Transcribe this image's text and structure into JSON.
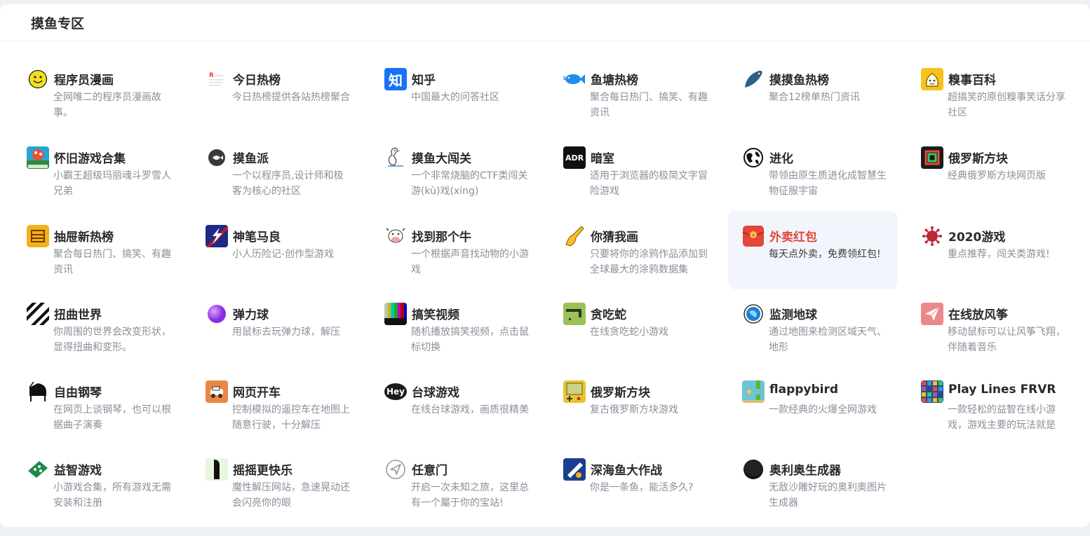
{
  "section": {
    "title": "摸鱼专区"
  },
  "items": [
    {
      "title": "程序员漫画",
      "desc": "全网唯二的程序员漫画故事。",
      "icon": "smiley-icon",
      "color": "#f4e01a"
    },
    {
      "title": "今日热榜",
      "desc": "今日热榜提供各站热榜聚合",
      "icon": "tophub-icon",
      "color": "#e34a3c"
    },
    {
      "title": "知乎",
      "desc": "中国最大的问答社区",
      "icon": "zhihu-icon",
      "color": "#1772f6",
      "glyph": "知"
    },
    {
      "title": "鱼塘热榜",
      "desc": "聚合每日热门、搞笑、有趣资讯",
      "icon": "fish-blue-icon",
      "color": "#1e8ee8"
    },
    {
      "title": "摸摸鱼热榜",
      "desc": "聚合12榜单热门资讯",
      "icon": "fish-dark-icon",
      "color": "#2b5f86"
    },
    {
      "title": "糗事百科",
      "desc": "超搞笑的原创糗事笑话分享社区",
      "icon": "qiushi-icon",
      "color": "#f7c21a"
    },
    {
      "title": "怀旧游戏合集",
      "desc": "小霸王超级玛丽魂斗罗雪人兄弟",
      "icon": "retro-game-icon",
      "color": "#2aa3d6"
    },
    {
      "title": "摸鱼派",
      "desc": "一个以程序员,设计师和极客为核心的社区",
      "icon": "fishpi-icon",
      "color": "#3a3a3a"
    },
    {
      "title": "摸鱼大闯关",
      "desc": "一个非常烧脑的CTF类闯关游(kù)戏(xíng)",
      "icon": "duck-icon",
      "color": "#444444"
    },
    {
      "title": "暗室",
      "desc": "适用于浏览器的极简文字冒险游戏",
      "icon": "adr-icon",
      "color": "#111111",
      "glyph": "ADR"
    },
    {
      "title": "进化",
      "desc": "带领由原生质进化成智慧生物征服宇宙",
      "icon": "globe-icon",
      "color": "#111111"
    },
    {
      "title": "俄罗斯方块",
      "desc": "经典俄罗斯方块网页版",
      "icon": "tetris-icon",
      "color": "#1b1b1b"
    },
    {
      "title": "抽屉新热榜",
      "desc": "聚合每日热门、搞笑、有趣资讯",
      "icon": "drawer-icon",
      "color": "#f2b318"
    },
    {
      "title": "神笔马良",
      "desc": "小人历险记-创作型游戏",
      "icon": "magic-pen-icon",
      "color": "#1f2a86"
    },
    {
      "title": "找到那个牛",
      "desc": "一个根据声音找动物的小游戏",
      "icon": "cow-icon",
      "color": "#e9a7a0"
    },
    {
      "title": "你猜我画",
      "desc": "只要将你的涂鸦作品添加到全球最大的涂鸦数据集",
      "icon": "hand-draw-icon",
      "color": "#f5c023"
    },
    {
      "title": "外卖红包",
      "desc": "每天点外卖，免费领红包!",
      "icon": "red-packet-icon",
      "color": "#e4463c",
      "active": true
    },
    {
      "title": "2020游戏",
      "desc": "重点推荐，闯关类游戏!",
      "icon": "virus-icon",
      "color": "#c0283a"
    },
    {
      "title": "扭曲世界",
      "desc": "你周围的世界会改变形状，显得扭曲和变形。",
      "icon": "twist-icon",
      "color": "#111111"
    },
    {
      "title": "弹力球",
      "desc": "用鼠标去玩弹力球，解压",
      "icon": "ball-icon",
      "color": "#8a2be2"
    },
    {
      "title": "搞笑视频",
      "desc": "随机播放搞笑视频，点击鼠标切换",
      "icon": "tv-bars-icon",
      "color": "#333333"
    },
    {
      "title": "贪吃蛇",
      "desc": "在线贪吃蛇小游戏",
      "icon": "snake-icon",
      "color": "#9bc25a"
    },
    {
      "title": "监测地球",
      "desc": "通过地图来检测区域天气、地形",
      "icon": "earth-icon",
      "color": "#1e7fd6"
    },
    {
      "title": "在线放风筝",
      "desc": "移动鼠标可以让风筝飞翔，伴随着音乐",
      "icon": "kite-icon",
      "color": "#e98a88"
    },
    {
      "title": "自由钢琴",
      "desc": "在网页上谈钢琴，也可以根据曲子演奏",
      "icon": "piano-icon",
      "color": "#111111"
    },
    {
      "title": "网页开车",
      "desc": "控制模拟的遥控车在地图上随意行驶，十分解压",
      "icon": "car-icon",
      "color": "#e98845"
    },
    {
      "title": "台球游戏",
      "desc": "在线台球游戏，画质很精美",
      "icon": "hey-icon",
      "color": "#1b1b1b",
      "glyph": "Hey"
    },
    {
      "title": "俄罗斯方块",
      "desc": "复古俄罗斯方块游戏",
      "icon": "gameboy-icon",
      "color": "#e7c52e"
    },
    {
      "title": "flappybird",
      "desc": "一款经典的火爆全网游戏",
      "icon": "flappy-icon",
      "color": "#6fc3d6"
    },
    {
      "title": "Play Lines FRVR",
      "desc": "一款轻松的益智在线小游戏，游戏主要的玩法就是",
      "icon": "lines-icon",
      "color": "#2b4a8a"
    },
    {
      "title": "益智游戏",
      "desc": "小游戏合集，所有游戏无需安装和注册",
      "icon": "puzzle-icon",
      "color": "#1d8a4a"
    },
    {
      "title": "摇摇更快乐",
      "desc": "魔性解压网站，急速晃动还会闪亮你的眼",
      "icon": "shake-icon",
      "color": "#111111"
    },
    {
      "title": "任意门",
      "desc": "开启一次未知之旅，这里总有一个屬于你的宝站!",
      "icon": "send-icon",
      "color": "#9a9a9a"
    },
    {
      "title": "深海鱼大作战",
      "desc": "你是一条鱼，能活多久?",
      "icon": "deep-sea-icon",
      "color": "#1a3f8f"
    },
    {
      "title": "奥利奥生成器",
      "desc": "无敌沙雕好玩的奥利奥图片生成器",
      "icon": "oreo-icon",
      "color": "#111111"
    }
  ]
}
